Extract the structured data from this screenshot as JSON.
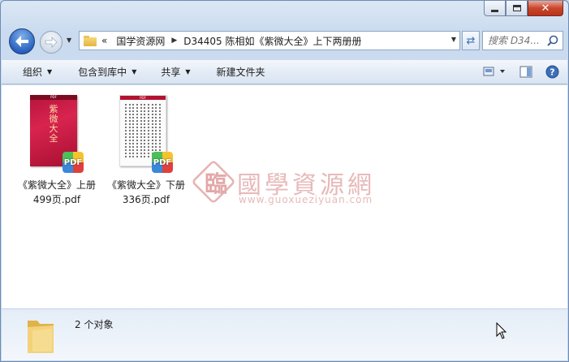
{
  "window": {
    "caption": {
      "minimize": "minimize",
      "maximize": "maximize",
      "close": "close"
    }
  },
  "nav": {
    "address": {
      "overflow": "«",
      "crumbs": [
        "国学资源网",
        "D34405 陈相如《紫微大全》上下两册册"
      ]
    },
    "search": {
      "placeholder": "搜索 D34..."
    }
  },
  "toolbar": {
    "organize": "组织",
    "include_in_library": "包含到库中",
    "share": "共享",
    "new_folder": "新建文件夹"
  },
  "files": [
    {
      "line1": "《紫微大全》上册",
      "line2": "499页.pdf",
      "badge": "PDF",
      "cover_top": "PDF",
      "cover_title": [
        "紫",
        "微",
        "大",
        "全"
      ]
    },
    {
      "line1": "《紫微大全》下册",
      "line2": "336页.pdf",
      "badge": "PDF",
      "cover_top": "PDF"
    }
  ],
  "watermark": {
    "title": "國學資源網",
    "url": "www.guoxueziyuan.com"
  },
  "status": {
    "count_text": "2 个对象"
  },
  "colors": {
    "window_frame": "#cadbef",
    "toolbar": "#e4ecf6",
    "close": "#c9462c",
    "accent": "#2a62c0"
  }
}
